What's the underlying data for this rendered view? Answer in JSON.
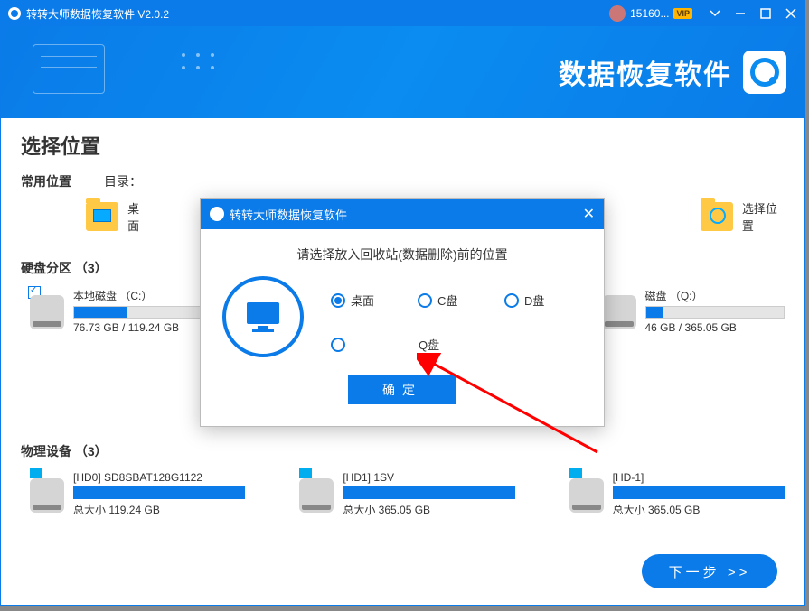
{
  "titlebar": {
    "title": "转转大师数据恢复软件 V2.0.2",
    "username": "15160...",
    "vip_label": "VIP"
  },
  "hero": {
    "brand": "数据恢复软件"
  },
  "page": {
    "title": "选择位置",
    "common_section": "常用位置",
    "dir_label": "目录：",
    "locations": {
      "desktop": "桌面",
      "select": "选择位置"
    },
    "partitions_section": "硬盘分区 （3）",
    "partitions": [
      {
        "name": "本地磁盘 （C:）",
        "size": "76.73 GB / 119.24 GB",
        "fill": 38,
        "checked": true
      },
      {
        "name": "磁盘 （Q:）",
        "size": "46 GB / 365.05 GB",
        "fill": 12,
        "checked": false
      }
    ],
    "devices_section": "物理设备 （3）",
    "devices": [
      {
        "name": "[HD0] SD8SBAT128G1122",
        "size": "总大小 119.24 GB"
      },
      {
        "name": "[HD1] 1SV",
        "size": "总大小 365.05 GB"
      },
      {
        "name": "[HD-1]",
        "size": "总大小 365.05 GB"
      }
    ],
    "next_button": "下一步 >>"
  },
  "dialog": {
    "title": "转转大师数据恢复软件",
    "prompt": "请选择放入回收站(数据删除)前的位置",
    "options": {
      "desktop": "桌面",
      "c": "C盘",
      "d": "D盘",
      "q": "Q盘"
    },
    "confirm": "确定"
  }
}
